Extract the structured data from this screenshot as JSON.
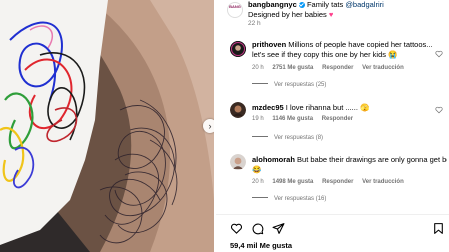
{
  "post": {
    "author": "bangbangnyc",
    "caption_text": "Family tats",
    "mention": "@badgalriri",
    "caption_line2": "Designed by her babies",
    "time": "22 h",
    "logo_text": "BANG"
  },
  "comments": [
    {
      "user": "prithoven",
      "text": "Millions of people have copied her tattoos... let's see if they copy this one by her kids",
      "emoji": "😭",
      "time": "20 h",
      "likes": "2751 Me gusta",
      "reply": "Responder",
      "translate": "Ver traducción",
      "replies": "Ver respuestas (25)"
    },
    {
      "user": "mzdec95",
      "text": "I love rihanna but ......",
      "emoji": "🫣",
      "time": "19 h",
      "likes": "1146 Me gusta",
      "reply": "Responder",
      "translate": "",
      "replies": "Ver respuestas (8)"
    },
    {
      "user": "alohomorah",
      "text": "But babe their drawings are only gonna get better",
      "emoji": "😂",
      "time": "20 h",
      "likes": "1498 Me gusta",
      "reply": "Responder",
      "translate": "Ver traducción",
      "replies": "Ver respuestas (16)"
    }
  ],
  "footer": {
    "likes": "59,4 mil Me gusta"
  },
  "icons": {
    "like": "heart-icon",
    "comment": "comment-icon",
    "share": "share-icon",
    "save": "bookmark-icon",
    "next": "chevron-right-icon"
  },
  "colors": {
    "link": "#00376b",
    "meta": "#737373",
    "verified": "#0095f6"
  }
}
